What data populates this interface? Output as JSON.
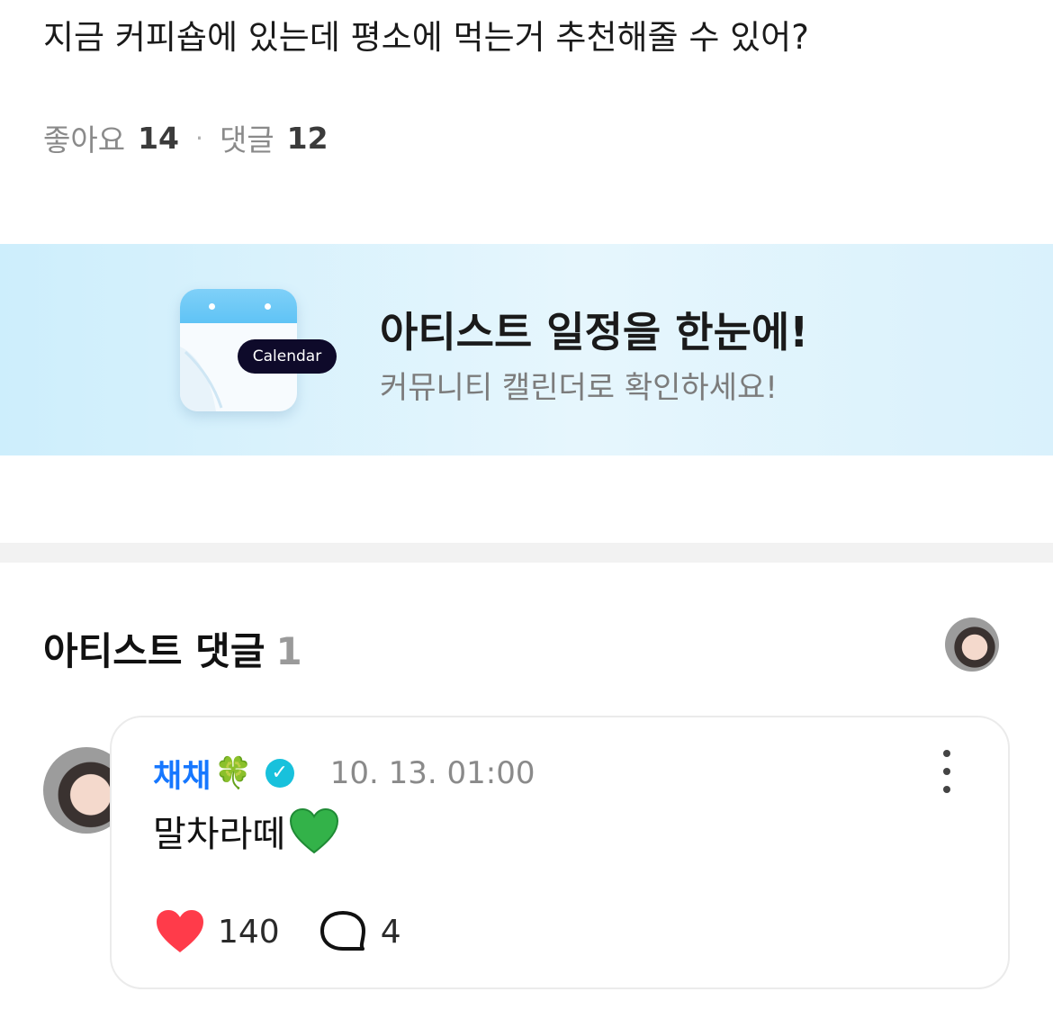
{
  "post": {
    "text": "지금 커피숍에 있는데 평소에 먹는거 추천해줄 수 있어?",
    "likes_label": "좋아요",
    "likes_count": "14",
    "separator": "·",
    "comments_label": "댓글",
    "comments_count": "12"
  },
  "banner": {
    "calendar_badge": "Calendar",
    "title": "아티스트 일정을 한눈에!",
    "subtitle": "커뮤니티 캘린더로 확인하세요!",
    "accent": "#5fc3f5"
  },
  "artist_comments": {
    "title": "아티스트 댓글",
    "count": "1"
  },
  "comment": {
    "author": "채채",
    "author_emoji": "🍀",
    "timestamp": "10. 13. 01:00",
    "text": "말차라떼",
    "likes": "140",
    "replies": "4",
    "name_color": "#1677ff",
    "heart_color": "#ff3b4a",
    "verified_color": "#18c1dc"
  }
}
